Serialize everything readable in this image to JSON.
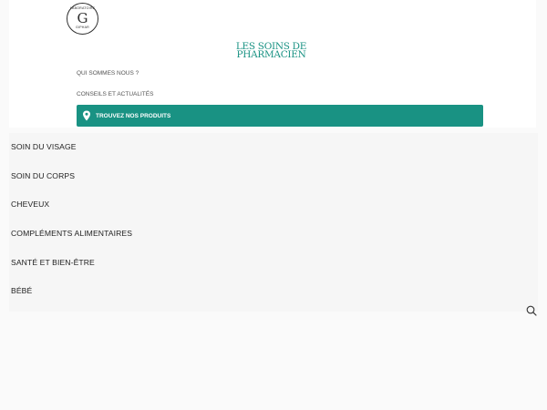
{
  "logo": {
    "letter": "G",
    "ring_top": "LABORATOIRE",
    "ring_bottom": "GIPHAR"
  },
  "brand": {
    "line1": "LES SOINS DE",
    "line2": "PHARMACIEN",
    "color": "#199283"
  },
  "top_links": [
    {
      "label": "QUI SOMMES NOUS ?"
    },
    {
      "label": "CONSEILS ET ACTUALITÉS"
    }
  ],
  "cta": {
    "label": "TROUVEZ NOS PRODUITS",
    "icon": "map-pin-icon",
    "color": "#199283"
  },
  "menu": [
    {
      "label": "SOIN DU VISAGE"
    },
    {
      "label": "SOIN DU CORPS"
    },
    {
      "label": "CHEVEUX"
    },
    {
      "label": "COMPLÉMENTS ALIMENTAIRES"
    },
    {
      "label": "SANTÉ ET BIEN-ÊTRE"
    },
    {
      "label": "BÉBÉ"
    }
  ],
  "search": {
    "icon": "search-icon"
  }
}
